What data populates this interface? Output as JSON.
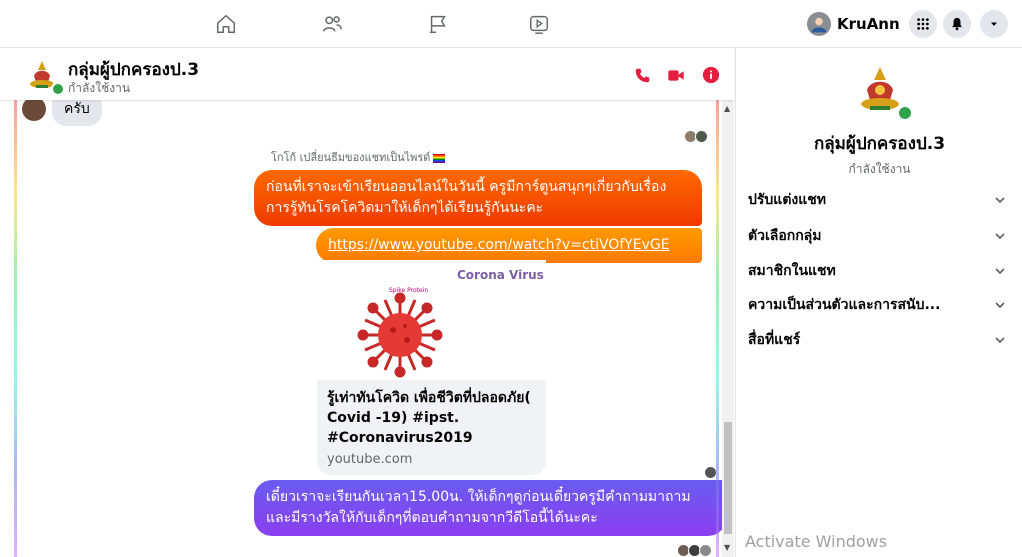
{
  "nav": {
    "icons": [
      "home-icon",
      "friends-icon",
      "pages-flag-icon",
      "watch-video-icon"
    ],
    "profile_name": "KruAnn"
  },
  "chat": {
    "title": "กลุ่มผู้ปกครองป.3",
    "status": "กำลังใช้งาน",
    "incoming_message": "ครับ",
    "system_note": "โกโก้ เปลี่ยนธีมของแชทเป็นไพรด์",
    "message_1": "ก่อนที่เราจะเข้าเรียนออนไลน์ในวันนี้ ครูมีการ์ตูนสนุกๆเกี่ยวกับเรื่องการรู้ทันโรคโควิดมาให้เด็กๆได้เรียนรู้กันนะคะ",
    "link_url": "https://www.youtube.com/watch?v=ctiVOfYEvGE",
    "link_preview": {
      "thumb_title": "Corona Virus",
      "thumb_subtitle": "Spike Protein",
      "title": "รู้เท่าทันโควิด เพื่อชีวิตที่ปลอดภัย( Covid -19) #ipst. #Coronavirus2019",
      "domain": "youtube.com"
    },
    "message_2": "เดี๋ยวเราจะเรียนกันเวลา15.00น. ให้เด็กๆดูก่อนเดี๋ยวครูมีคำถามมาถามและมีรางวัลให้กับเด็กๆที่ตอบคำถามจากวีดีโอนี้ได้นะคะ"
  },
  "panel": {
    "title": "กลุ่มผู้ปกครองป.3",
    "status": "กำลังใช้งาน",
    "items": [
      {
        "label": "ปรับแต่งแชท"
      },
      {
        "label": "ตัวเลือกกลุ่ม"
      },
      {
        "label": "สมาชิกในแชท"
      },
      {
        "label": "ความเป็นส่วนตัวและการสนับ..."
      },
      {
        "label": "สื่อที่แชร์"
      }
    ]
  },
  "watermark": "Activate Windows",
  "colors": {
    "accent_red": "#e41e3f",
    "bubble_orange": "#ff6a00",
    "bubble_purple": "#7b4ff0",
    "online": "#31a24c"
  }
}
